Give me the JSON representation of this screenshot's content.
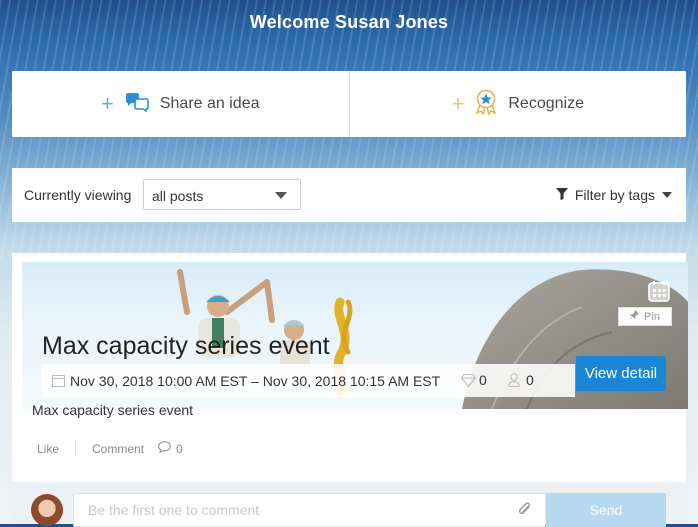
{
  "header": {
    "welcome_text": "Welcome Susan Jones"
  },
  "actions": {
    "share_label": "Share an idea",
    "recognize_label": "Recognize",
    "plus": "+"
  },
  "filters": {
    "currently_viewing_label": "Currently viewing",
    "selected_view": "all posts",
    "filter_by_tags_label": "Filter by tags"
  },
  "post": {
    "title": "Max capacity series event",
    "pin_label": "Pin",
    "date_range": "Nov 30, 2018 10:00 AM EST – Nov 30, 2018 10:15 AM EST",
    "gems_count": "0",
    "attendees_count": "0",
    "view_detail_label": "View detail",
    "description": "Max capacity series event",
    "like_label": "Like",
    "comment_label": "Comment",
    "comment_count": "0"
  },
  "comment": {
    "placeholder": "Be the first one to comment",
    "send_label": "Send"
  },
  "icons": {
    "share": "speech-bubbles-icon",
    "recognize": "award-ribbon-icon",
    "filter": "funnel-icon",
    "calendar": "calendar-icon",
    "gem": "diamond-icon",
    "person": "person-icon",
    "comment": "comment-bubble-icon",
    "attach": "paperclip-icon",
    "pin": "pin-icon"
  },
  "colors": {
    "primary_button": "#1a86d8",
    "send_button": "#b7d8f1",
    "share_plus": "#5aaee6",
    "recognize_plus": "#f0c36b"
  }
}
